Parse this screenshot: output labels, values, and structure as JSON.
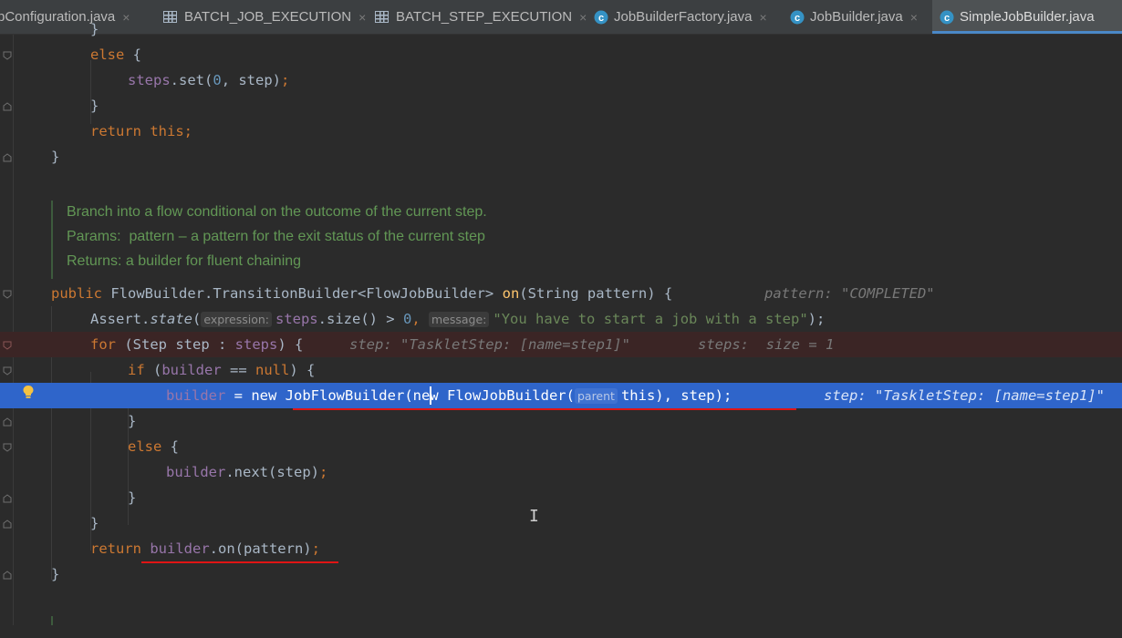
{
  "tabs": [
    {
      "label": "bConfiguration.java",
      "icon": "none",
      "active": false
    },
    {
      "label": "BATCH_JOB_EXECUTION",
      "icon": "table-icon",
      "active": false
    },
    {
      "label": "BATCH_STEP_EXECUTION",
      "icon": "table-icon",
      "active": false
    },
    {
      "label": "JobBuilderFactory.java",
      "icon": "class-icon",
      "active": false
    },
    {
      "label": "JobBuilder.java",
      "icon": "class-icon",
      "active": false
    },
    {
      "label": "SimpleJobBuilder.java",
      "icon": "class-icon",
      "active": true
    }
  ],
  "close_glyph": "×",
  "code": {
    "l0": "}",
    "l1_else": "else",
    "l1_brace": " {",
    "l2_steps": "steps",
    "l2_rest": ".set(",
    "l2_num": "0",
    "l2_tail": ", step)",
    "l2_semi": ";",
    "l3": "}",
    "l4_return": "return",
    "l4_this": " this",
    "l4_semi": ";",
    "l5": "}",
    "doc1": "Branch into a flow conditional on the outcome of the current step.",
    "doc2": "Params:  pattern – a pattern for the exit status of the current step",
    "doc3": "Returns: a builder for fluent chaining",
    "l8_public": "public",
    "l8_sig": " FlowBuilder.TransitionBuilder<FlowJobBuilder> ",
    "l8_on": "on",
    "l8_params": "(String pattern) {",
    "l8_hint": "pattern: \"COMPLETED\"",
    "l9_assert": "Assert.",
    "l9_state": "state",
    "l9_open": "(",
    "l9_p1": "expression:",
    "l9_steps": "steps",
    "l9_mid": ".size() > ",
    "l9_num": "0",
    "l9_comma": ", ",
    "l9_p2": "message:",
    "l9_str": "\"You have to start a job with a step\"",
    "l9_close": ");",
    "l10_for": "for",
    "l10_rest": " (Step step : ",
    "l10_steps": "steps",
    "l10_brace": ") {",
    "l10_hint1": "step: \"TaskletStep: [name=step1]\"",
    "l10_hint2": "steps:  size = 1",
    "l11_if": "if",
    "l11_open": " (",
    "l11_builder": "builder",
    "l11_mid": " == ",
    "l11_null": "null",
    "l11_close": ") {",
    "l12_builder": "builder",
    "l12_eq": " = ",
    "l12_new": "new",
    "l12_cls": " JobFlowBuilder",
    "l12_paren": "(",
    "l12_new2": "new",
    "l12_cls2": " FlowJobBuilder(",
    "l12_pname": "parent",
    "l12_this": "this",
    "l12_tail": "), step)",
    "l12_semi": ";",
    "l12_hint": "step: \"TaskletStep: [name=step1]\"",
    "l13": "}",
    "l14_else": "else",
    "l14_brace": " {",
    "l15_builder": "builder",
    "l15_rest": ".next(step)",
    "l15_semi": ";",
    "l16": "}",
    "l17": "}",
    "l18_return": "return",
    "l18_builder": " builder",
    "l18_rest": ".on(pattern)",
    "l18_semi": ";",
    "l19": "}"
  }
}
